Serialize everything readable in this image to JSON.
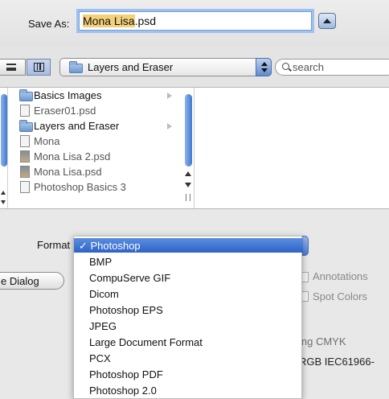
{
  "save_as": {
    "label": "Save As:",
    "filename_selected": "Mona Lisa",
    "filename_ext": ".psd"
  },
  "toolbar": {
    "location": "Layers and Eraser",
    "search_placeholder": "search"
  },
  "browser": {
    "items": [
      {
        "name": "Basics Images",
        "kind": "folder",
        "has_children": true
      },
      {
        "name": "Eraser01.psd",
        "kind": "file",
        "has_children": false
      },
      {
        "name": "Layers and Eraser",
        "kind": "folder",
        "has_children": true
      },
      {
        "name": "Mona",
        "kind": "doc",
        "has_children": false
      },
      {
        "name": "Mona Lisa 2.psd",
        "kind": "image",
        "has_children": false
      },
      {
        "name": "Mona Lisa.psd",
        "kind": "image",
        "has_children": false
      },
      {
        "name": "Photoshop Basics 3",
        "kind": "doc",
        "has_children": false
      }
    ]
  },
  "options": {
    "format_label": "Format",
    "dialog_button": "e Dialog",
    "annotations": "Annotations",
    "spot_colors": "Spot Colors",
    "cmyk_text": "ing CMYK",
    "profile_text": "RGB IEC61966-"
  },
  "format_menu": {
    "selected": "✓ Photoshop",
    "items": [
      "BMP",
      "CompuServe GIF",
      "Dicom",
      "Photoshop EPS",
      "JPEG",
      "Large Document Format",
      "PCX",
      "Photoshop PDF",
      "Photoshop 2.0"
    ]
  }
}
